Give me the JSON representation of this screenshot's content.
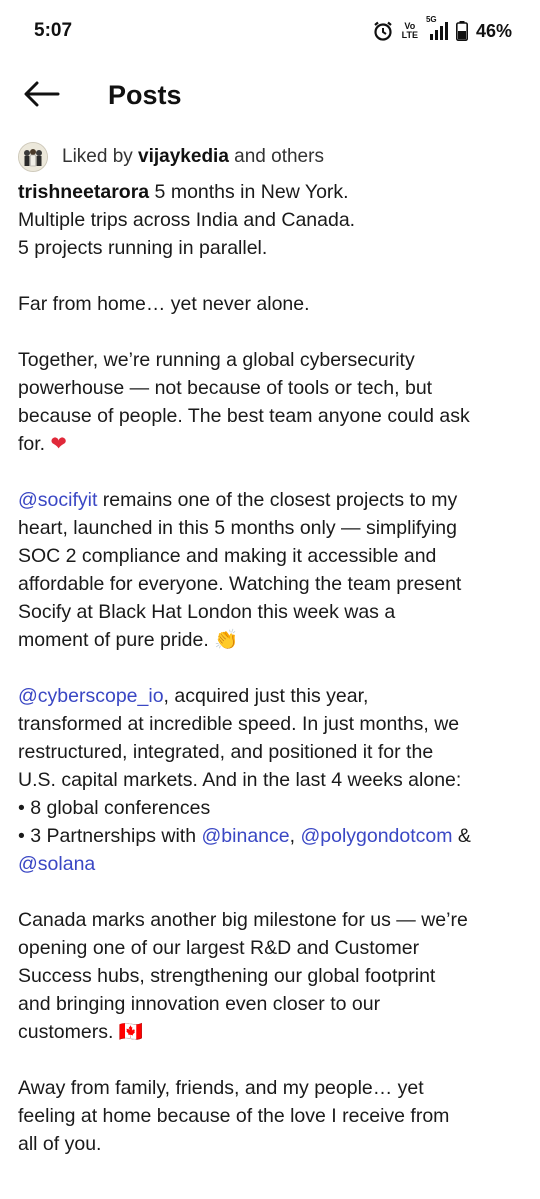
{
  "status_bar": {
    "time": "5:07",
    "network_label_top": "Vo",
    "network_label_bottom": "LTE",
    "network_type": "5G",
    "battery": "46%",
    "icons": [
      "alarm-icon",
      "volte-icon",
      "signal-icon",
      "battery-icon"
    ]
  },
  "header": {
    "title": "Posts",
    "back_icon": "arrow-left-icon"
  },
  "likes": {
    "prefix": "Liked by ",
    "user": "vijaykedia",
    "suffix": " and others"
  },
  "post": {
    "author": "trishneetarora",
    "p1": {
      "l1": " 5 months in New York.",
      "l2": "Multiple trips across India and Canada.",
      "l3": "5 projects running in parallel."
    },
    "p2": {
      "l1": "Far from home… yet never alone."
    },
    "p3": {
      "l1": "Together, we’re running a global cybersecurity",
      "l2": "powerhouse — not because of tools or tech, but",
      "l3": "because of people. The best team anyone could ask",
      "l4": "for. ",
      "heart": "❤"
    },
    "p4": {
      "mention": "@socifyit",
      "l1_rest": " remains one of the closest projects to my",
      "l2": "heart, launched in this 5 months only — simplifying",
      "l3": "SOC 2 compliance and making it accessible and",
      "l4": "affordable for everyone. Watching the team present",
      "l5": "Socify at Black Hat London this week was a",
      "l6": "moment of pure pride. 👏"
    },
    "p5": {
      "mention": "@cyberscope_io",
      "l1_rest": ", acquired just this year,",
      "l2": "transformed at incredible speed. In just months, we",
      "l3": "restructured, integrated, and positioned it for the",
      "l4": "U.S. capital markets. And in the last 4 weeks alone:",
      "l5": "• 8 global conferences",
      "l6_prefix": "• 3 Partnerships with ",
      "mention_binance": "@binance",
      "sep": ", ",
      "mention_polygon": "@polygondotcom",
      "amp": " &",
      "mention_solana": "@solana"
    },
    "p6": {
      "l1": "Canada marks another big milestone for us — we’re",
      "l2": "opening one of our largest R&D and Customer",
      "l3": "Success hubs, strengthening our global footprint",
      "l4": "and bringing innovation even closer to our",
      "l5": "customers. 🇨🇦"
    },
    "p7": {
      "l1": "Away from family, friends, and my people… yet",
      "l2": "feeling at home because of the love I receive from",
      "l3": "all of you."
    }
  },
  "colors": {
    "mention": "#3a47c4",
    "text": "#1a1a1a",
    "heart": "#e0293a"
  }
}
